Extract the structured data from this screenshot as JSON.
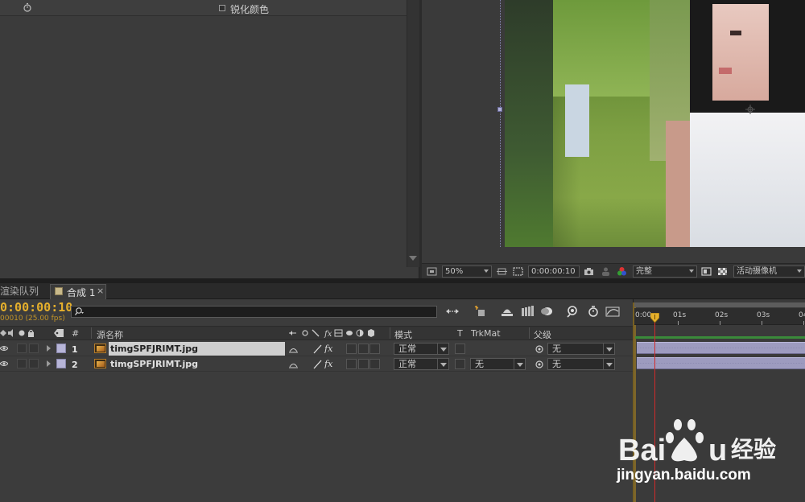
{
  "effect_controls": {
    "sharpen_color_label": "锐化颜色",
    "sharpen_color_checked": false
  },
  "viewer_toolbar": {
    "zoom": "50%",
    "timecode": "0:00:00:10",
    "resolution": "完整",
    "camera": "活动摄像机"
  },
  "tabs": {
    "render_queue": "渲染队列",
    "composition": "合成 1",
    "close": "×"
  },
  "timeline": {
    "timecode": "0:00:00:10",
    "frame_info": "00010 (25.00 fps)",
    "search_placeholder": "",
    "columns": {
      "num": "#",
      "source_name": "源名称",
      "mode": "模式",
      "t": "T",
      "trkmat": "TrkMat",
      "parent": "父级"
    },
    "layers": [
      {
        "num": "1",
        "name": "timgSPFJRIMT.jpg",
        "selected": true,
        "mode": "正常",
        "trkmat": "",
        "parent": "无"
      },
      {
        "num": "2",
        "name": "timgSPFJRIMT.jpg",
        "selected": false,
        "mode": "正常",
        "trkmat": "无",
        "parent": "无"
      }
    ],
    "layer_color": "#b7b5d8",
    "playhead_color": "#d22a2a",
    "timecode_color": "#e6b02c"
  },
  "ruler": {
    "labels": [
      "0:00s",
      "01s",
      "02s",
      "03s",
      "04"
    ]
  },
  "watermark": {
    "site": "jingyan.baidu.com"
  }
}
